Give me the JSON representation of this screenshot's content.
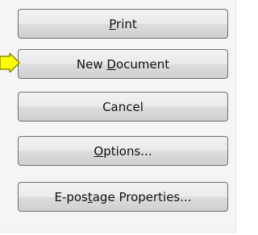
{
  "buttons": {
    "print": {
      "pre": "",
      "key": "P",
      "post": "rint"
    },
    "new_document": {
      "pre": "New ",
      "key": "D",
      "post": "ocument"
    },
    "cancel": {
      "pre": "Cancel",
      "key": "",
      "post": ""
    },
    "options": {
      "pre": "",
      "key": "O",
      "post": "ptions..."
    },
    "epostage": {
      "pre": "E-pos",
      "key": "t",
      "post": "age Properties..."
    }
  },
  "colors": {
    "pointer_fill": "#ffff00",
    "pointer_stroke": "#8a8a00",
    "button_border": "#707070",
    "panel_bg": "#f5f5f5"
  }
}
